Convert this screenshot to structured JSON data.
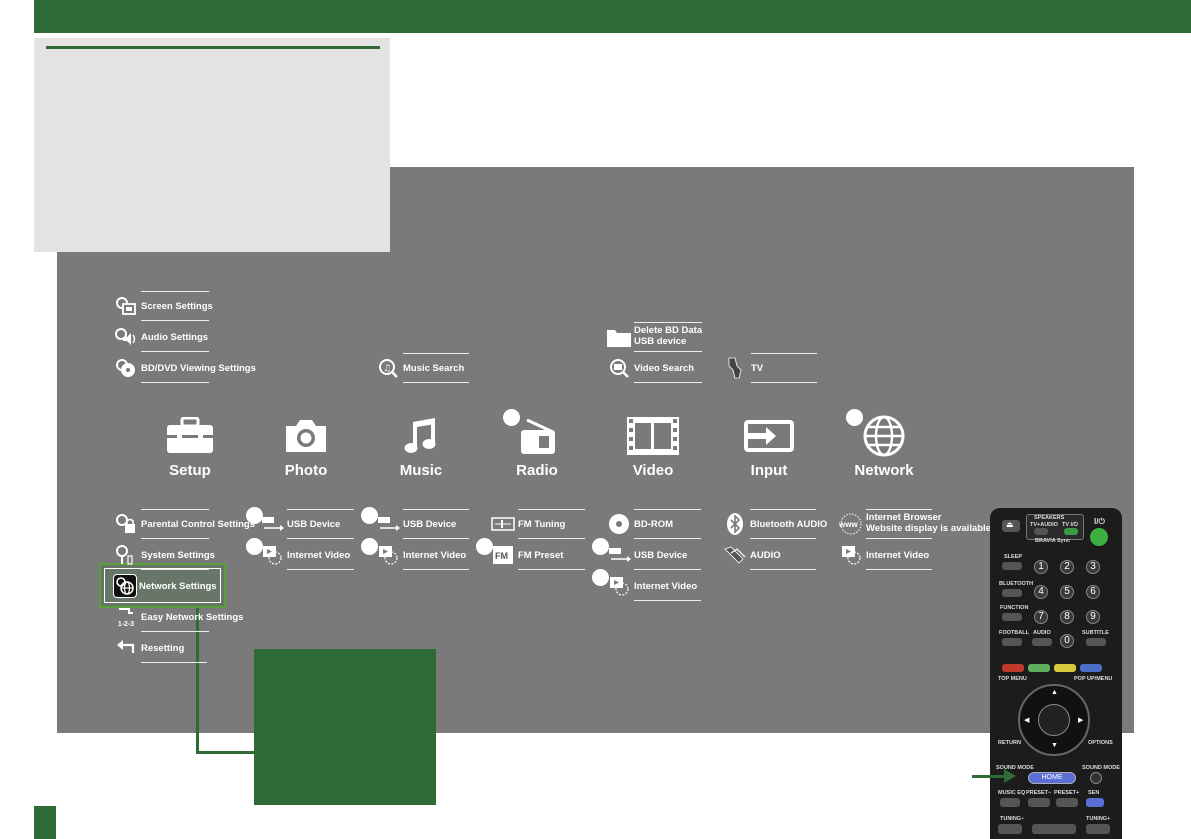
{
  "menu": {
    "top_left": [
      {
        "label": "Screen Settings",
        "icon": "screen-settings-icon"
      },
      {
        "label": "Audio Settings",
        "icon": "audio-settings-icon"
      },
      {
        "label": "BD/DVD Viewing Settings",
        "icon": "bd-dvd-settings-icon"
      }
    ],
    "music_search": "Music Search",
    "delete_bd_data_1": "Delete BD Data",
    "delete_bd_data_2": "USB device",
    "video_search": "Video Search",
    "tv": "TV",
    "categories": [
      {
        "label": "Setup",
        "icon": "toolbox-icon"
      },
      {
        "label": "Photo",
        "icon": "camera-icon"
      },
      {
        "label": "Music",
        "icon": "music-note-icon"
      },
      {
        "label": "Radio",
        "icon": "radio-icon"
      },
      {
        "label": "Video",
        "icon": "film-icon"
      },
      {
        "label": "Input",
        "icon": "input-icon"
      },
      {
        "label": "Network",
        "icon": "globe-icon"
      }
    ],
    "setup_items": [
      "Parental Control Settings",
      "System Settings",
      "Network Settings",
      "Easy Network Settings",
      "Resetting"
    ],
    "photo_items": [
      "USB Device",
      "Internet Video"
    ],
    "music_items": [
      "USB Device",
      "Internet Video"
    ],
    "radio_items": [
      "FM Tuning",
      "FM Preset"
    ],
    "video_items": [
      "BD-ROM",
      "USB Device",
      "Internet Video"
    ],
    "input_items": [
      "Bluetooth AUDIO",
      "AUDIO"
    ],
    "network_items": {
      "browser_1": "Internet Browser",
      "browser_2": "Website display is available",
      "internet_video": "Internet Video"
    },
    "easy_network_prefix": "1-2-3"
  },
  "remote": {
    "speakers": "SPEAKERS",
    "tv_audio": "TV+AUDIO",
    "tv_power": "TV I/⏻",
    "bravia_sync": "BRAVIA Sync",
    "power": "I/⏻",
    "sleep": "SLEEP",
    "bluetooth": "BLUETOOTH",
    "function": "FUNCTION",
    "football": "FOOTBALL",
    "audio": "AUDIO",
    "subtitle": "SUBTITLE",
    "top_menu": "TOP MENU",
    "popup_menu": "POP UP/MENU",
    "return": "RETURN",
    "options": "OPTIONS",
    "sound_mode_l": "SOUND MODE",
    "sound_mode_r": "SOUND MODE",
    "home": "HOME",
    "music_eq": "MUSIC EQ",
    "preset_minus": "PRESET−",
    "preset_plus": "PRESET+",
    "sen": "SEN",
    "tuning_minus": "TUNING−",
    "tuning_plus": "TUNING+",
    "numbers": [
      "1",
      "2",
      "3",
      "4",
      "5",
      "6",
      "7",
      "8",
      "9",
      "0"
    ]
  },
  "colors": {
    "accent_green": "#2e6b37",
    "screen_gray": "#7a7a7a",
    "panel_gray": "#e3e3e3"
  }
}
